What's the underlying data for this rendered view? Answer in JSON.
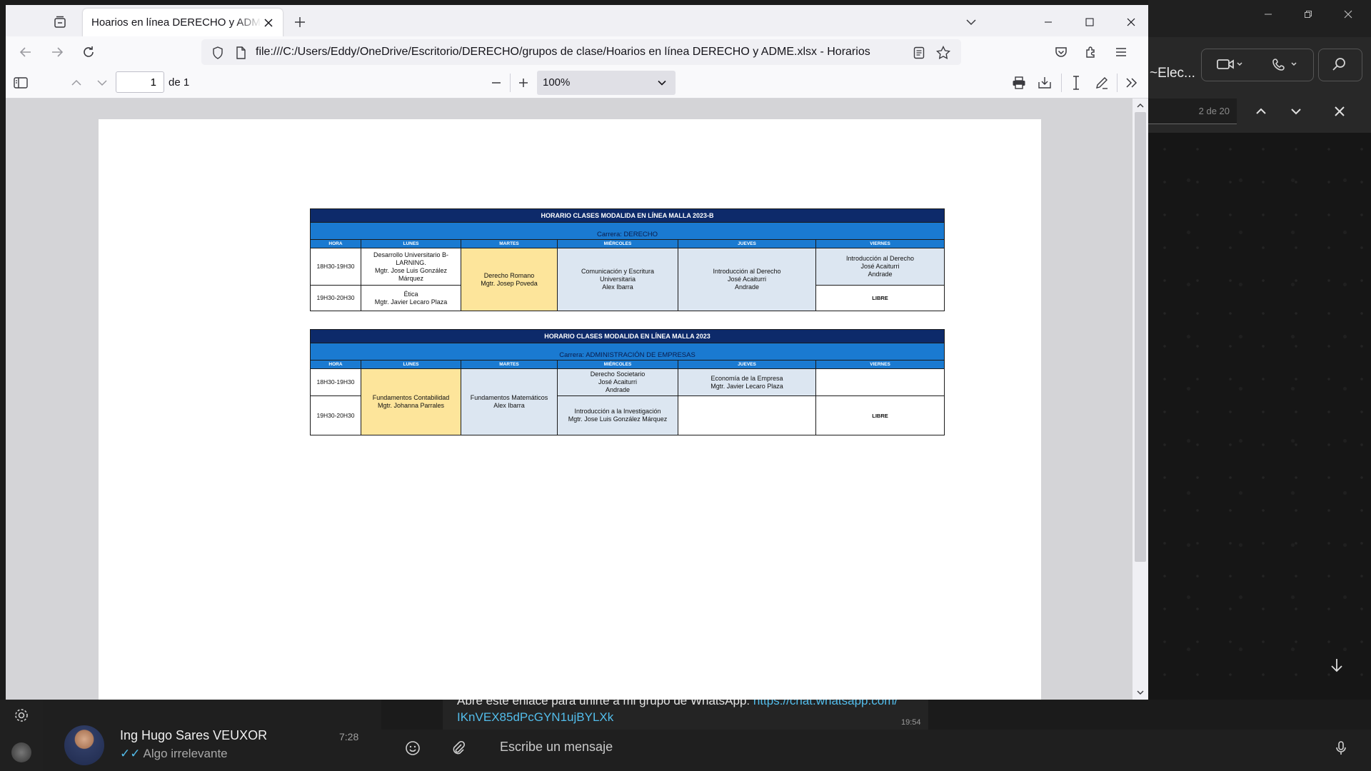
{
  "browser": {
    "tab_title": "Hoarios en línea DERECHO y ADME.xlsx",
    "url": "file:///C:/Users/Eddy/OneDrive/Escritorio/DERECHO/grupos de clase/Hoarios en línea DERECHO y ADME.xlsx - Horarios",
    "window_controls": {
      "minimize": "—",
      "maximize": "☐",
      "close": "✕"
    }
  },
  "pdf_toolbar": {
    "page_number": "1",
    "page_of": "de 1",
    "zoom": "100%"
  },
  "schedule_1": {
    "title": "HORARIO CLASES MODALIDA EN LÍNEA MALLA 2023-B",
    "career": "Carrera: DERECHO",
    "headers": [
      "HORA",
      "LUNES",
      "MARTES",
      "MIÉRCOLES",
      "JUEVES",
      "VIERNES"
    ],
    "slot1": "18H30-19H30",
    "slot2": "19H30-20H30",
    "lunes_1": [
      "Desarrollo Universitario B-",
      "LARNING.",
      "Mgtr. Jose Luis González",
      "Márquez"
    ],
    "lunes_2": [
      "Ética",
      "Mgtr. Javier Lecaro Plaza"
    ],
    "martes": [
      "Derecho Romano",
      "Mgtr. Josep Poveda"
    ],
    "miercoles": [
      "Comunicación y Escritura",
      "Universitaria",
      "Alex Ibarra"
    ],
    "jueves": [
      "Introducción al Derecho",
      "José Acaiturri",
      "Andrade"
    ],
    "viernes_1": [
      "Introducción al Derecho",
      "José Acaiturri",
      "Andrade"
    ],
    "viernes_2": "LIBRE"
  },
  "schedule_2": {
    "title": "HORARIO CLASES MODALIDA EN LÍNEA MALLA 2023",
    "career": "Carrera: ADMINISTRACIÓN DE EMPRESAS",
    "headers": [
      "HORA",
      "LUNES",
      "MARTES",
      "MIÉRCOLES",
      "JUEVES",
      "VIERNES"
    ],
    "slot1": "18H30-19H30",
    "slot2": "19H30-20H30",
    "lunes": [
      "Fundamentos Contabilidad",
      "Mgtr. Johanna Parrales"
    ],
    "martes": [
      "Fundamentos Matemáticos",
      "Alex Ibarra"
    ],
    "miercoles_1": [
      "Derecho Societario",
      "José Acaiturri",
      "Andrade"
    ],
    "miercoles_2": [
      "Introducción a la  Investigación",
      "Mgtr. Jose Luis González Márquez"
    ],
    "jueves_1": [
      "Economía de la Empresa",
      "Mgtr. Javier Lecaro Plaza"
    ],
    "viernes_2": "LIBRE"
  },
  "whatsapp": {
    "chat_title": "~Elec...",
    "search_counter": "2 de 20",
    "contact_name": "Ing Hugo Sares VEUXOR",
    "contact_time": "7:28",
    "contact_ticks": "✓✓",
    "contact_preview": "Algo irrelevante",
    "message_text": "Abre este enlace para unirte a mi grupo de WhatsApp:",
    "message_link_1": "https://chat.whatsapp.com/",
    "message_link_2": "IKnVEX85dPcGYN1ujBYLXk",
    "message_time": "19:54",
    "compose_placeholder": "Escribe un mensaje"
  },
  "colors": {
    "title_bar": "#0d2a6a",
    "header_blue": "#1a7ad1",
    "cell_yellow": "#fde59b",
    "cell_blue": "#dce6f1",
    "wa_link": "#53bdeb"
  }
}
